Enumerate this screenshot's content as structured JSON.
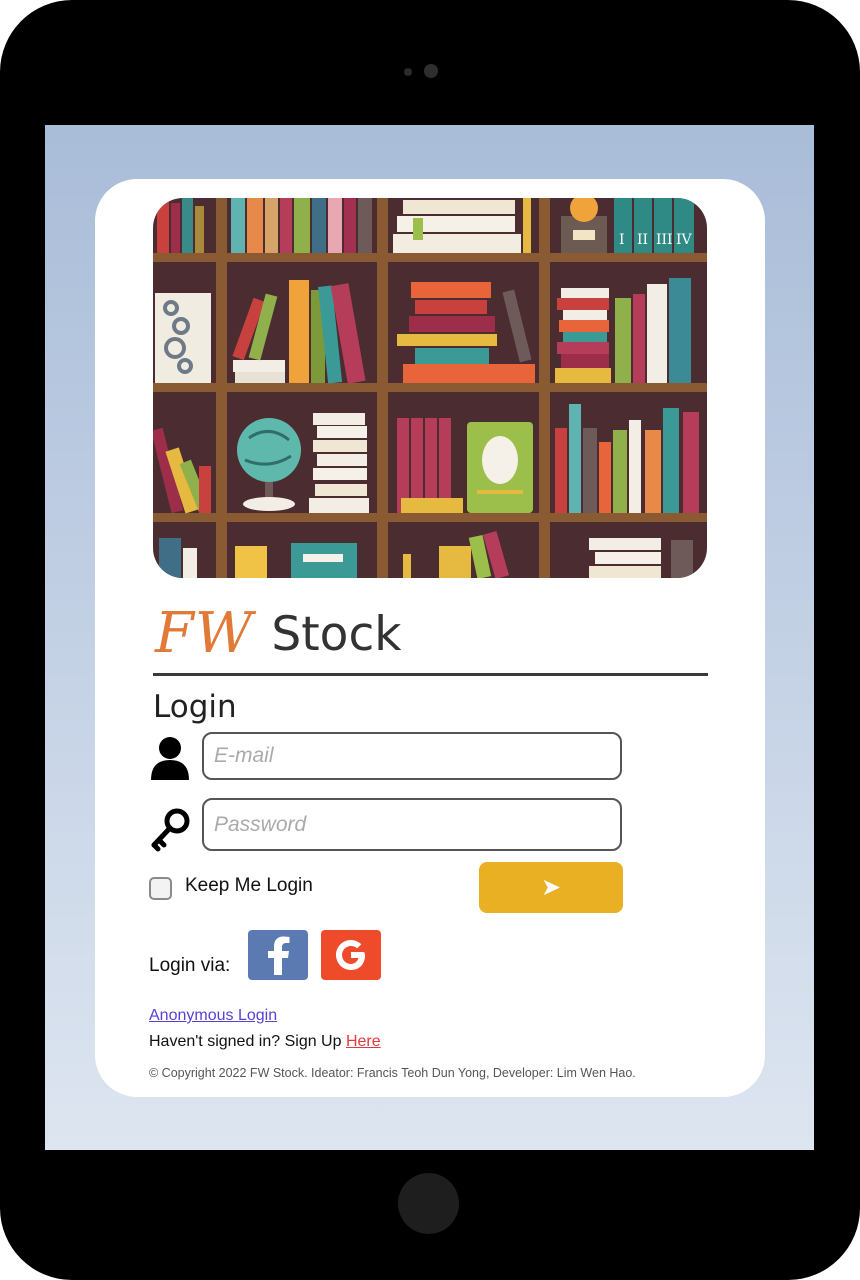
{
  "brand": {
    "fw": "FW",
    "name": "Stock",
    "fw_color": "#e07a36"
  },
  "login": {
    "title": "Login",
    "email_placeholder": "E-mail",
    "password_placeholder": "Password",
    "keep_label": "Keep Me Login",
    "submit_symbol": "➤",
    "submit_color": "#e8b022"
  },
  "social": {
    "label": "Login via:",
    "facebook": {
      "letter": "f",
      "color": "#5b7ab2",
      "icon": "facebook-icon"
    },
    "google": {
      "letter": "G",
      "color": "#ee4b2b",
      "icon": "google-icon"
    }
  },
  "links": {
    "anonymous": "Anonymous Login",
    "signup_prefix": "Haven't signed in? Sign Up ",
    "signup_link": "Here"
  },
  "footer": {
    "copyright": "© Copyright 2022 FW Stock. Ideator: Francis Teoh Dun Yong, Developer: Lim Wen Hao."
  },
  "banner": {
    "icon": "bookshelf-illustration",
    "roman_numerals": [
      "I",
      "II",
      "III",
      "IV"
    ]
  }
}
